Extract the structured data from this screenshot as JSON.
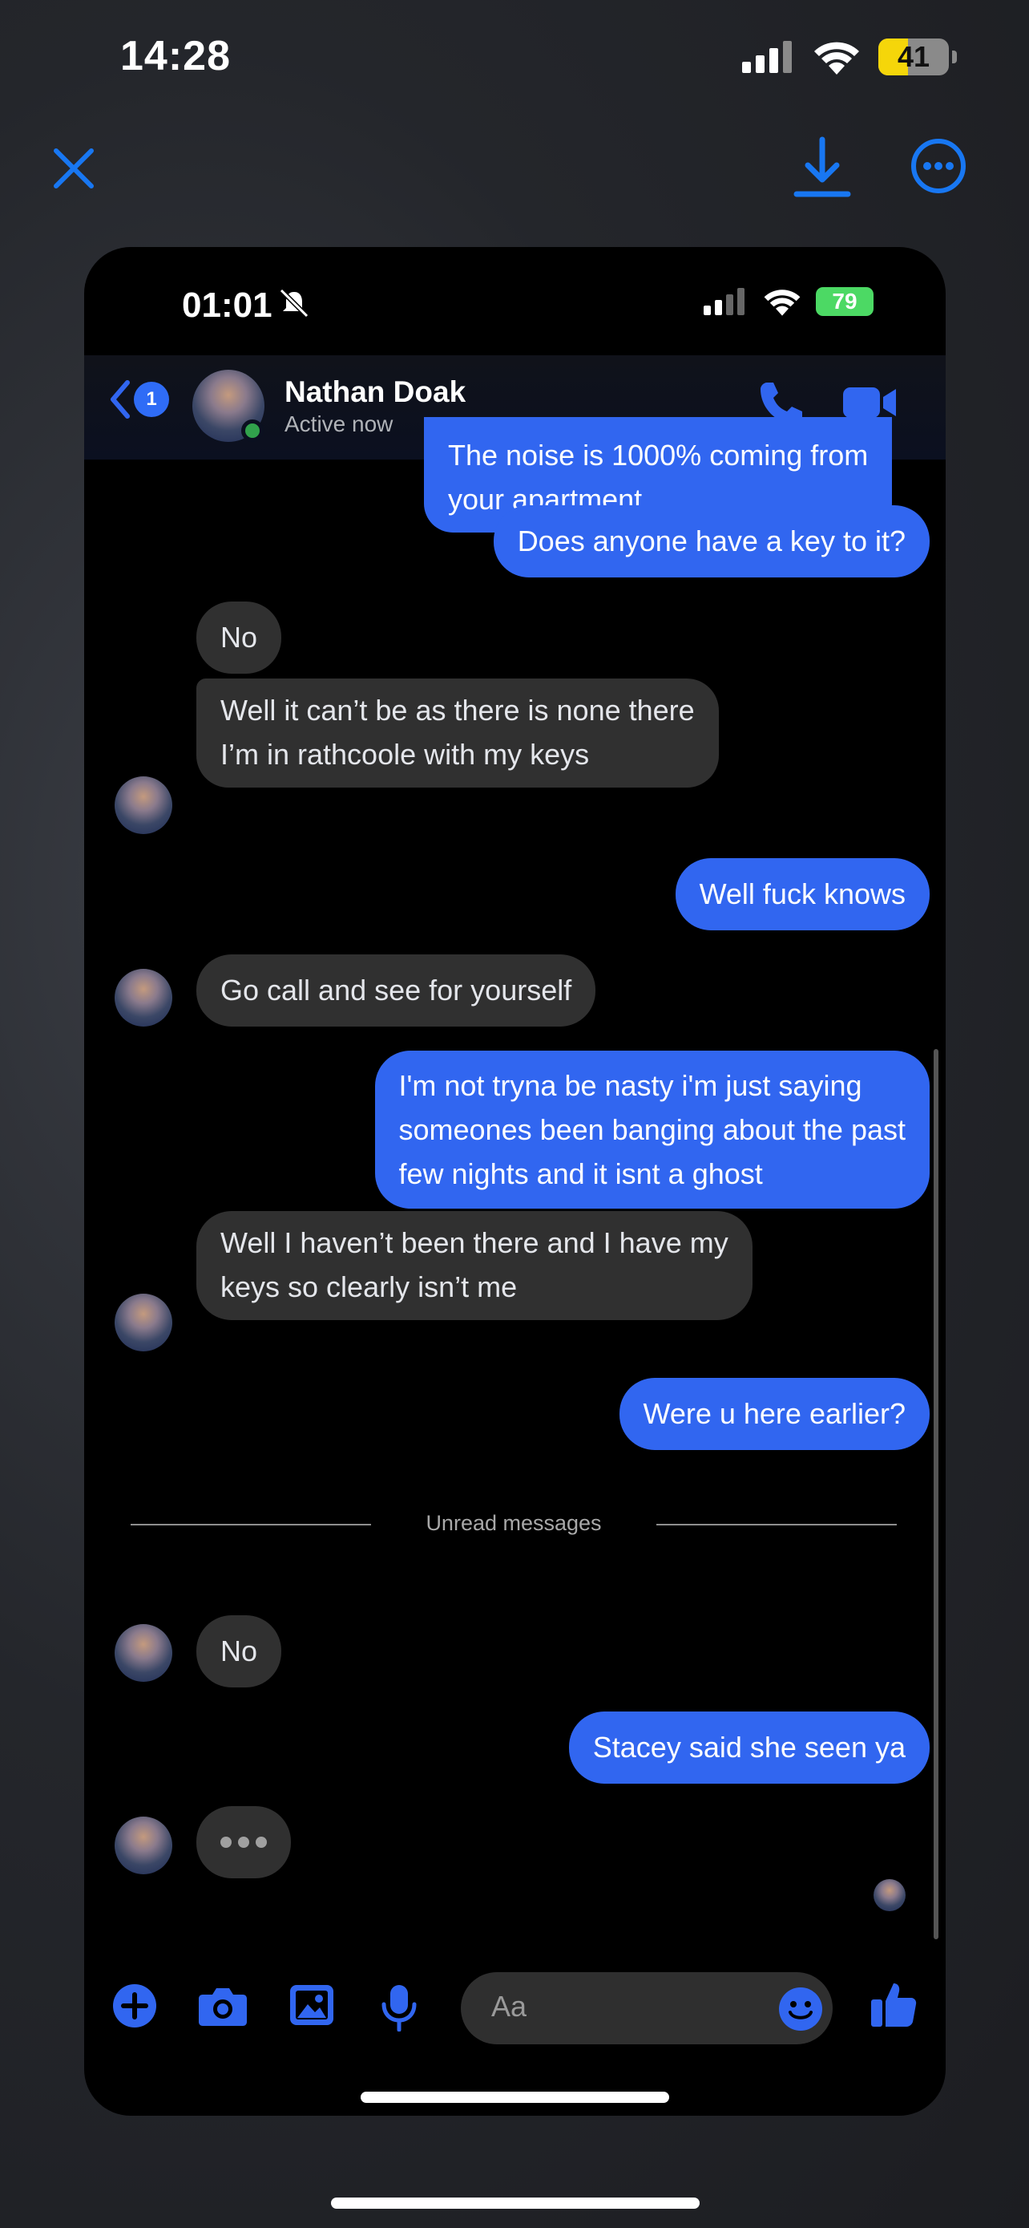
{
  "outer_status": {
    "time": "14:28",
    "battery": "41"
  },
  "viewer": {
    "close_icon": "close-icon",
    "download_icon": "download-icon",
    "more_icon": "more-options-icon",
    "accent": "#1877f2"
  },
  "inner_status": {
    "time": "01:01",
    "battery": "79"
  },
  "header": {
    "back_badge": "1",
    "name": "Nathan Doak",
    "status": "Active now",
    "accent": "#3166f0"
  },
  "messages": [
    {
      "dir": "out",
      "lines": [
        "The noise is 1000% coming from",
        "your apartment"
      ]
    },
    {
      "dir": "out",
      "lines": [
        "Does anyone have a key to it?"
      ]
    },
    {
      "dir": "in",
      "lines": [
        "No"
      ]
    },
    {
      "dir": "in",
      "lines": [
        "Well it can’t be as there is none there",
        "I’m in rathcoole with my keys"
      ]
    },
    {
      "dir": "out",
      "lines": [
        "Well fuck knows"
      ]
    },
    {
      "dir": "in",
      "lines": [
        "Go call and see for yourself"
      ]
    },
    {
      "dir": "out",
      "lines": [
        "I'm not tryna be nasty i'm just saying",
        "someones been banging about the past",
        "few nights and it isnt a ghost"
      ]
    },
    {
      "dir": "in",
      "lines": [
        "Well I haven’t been there and I have my",
        "keys so clearly isn’t me"
      ]
    },
    {
      "dir": "out",
      "lines": [
        "Were u here earlier?"
      ]
    },
    {
      "dir": "in",
      "lines": [
        "No"
      ]
    },
    {
      "dir": "out",
      "lines": [
        "Stacey said she seen ya"
      ]
    }
  ],
  "divider_label": "Unread messages",
  "composer": {
    "placeholder": "Aa"
  }
}
